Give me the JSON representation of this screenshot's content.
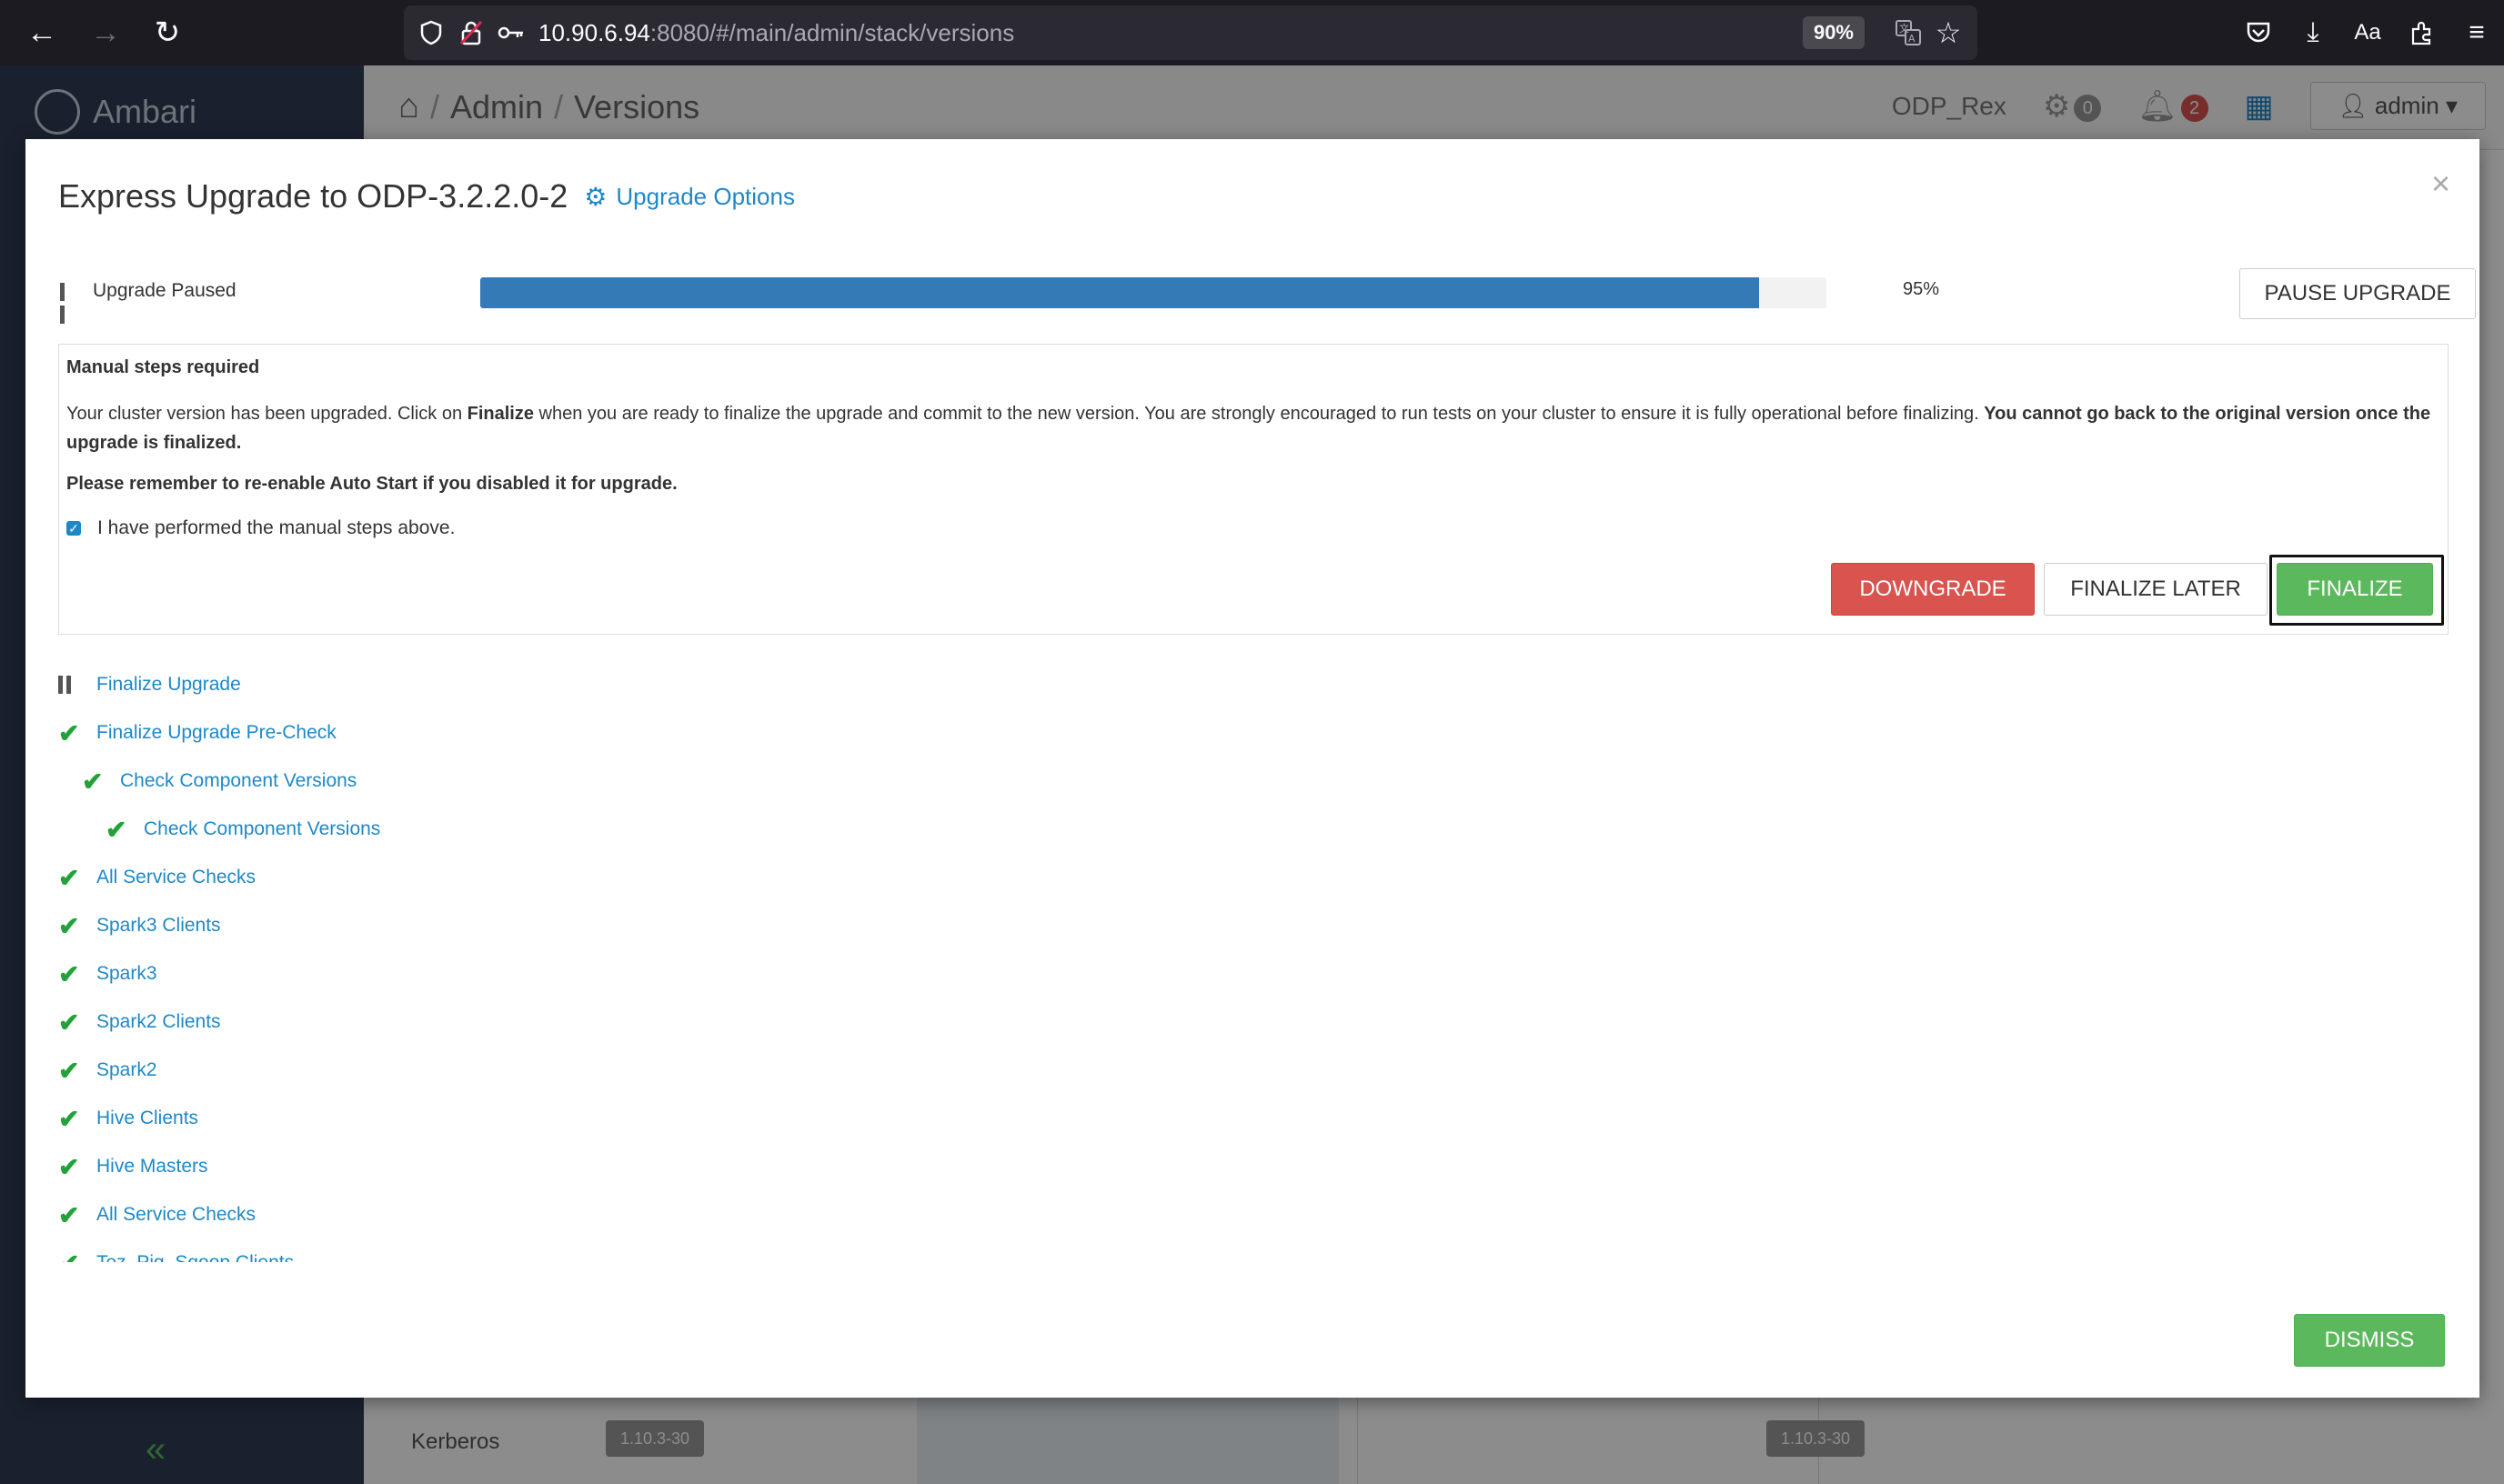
{
  "browser": {
    "url_host": "10.90.6.94",
    "url_rest": ":8080/#/main/admin/stack/versions",
    "zoom": "90%",
    "reader_label": "Aa"
  },
  "app": {
    "logo": "Ambari",
    "breadcrumb": [
      "Admin",
      "Versions"
    ],
    "cluster": "ODP_Rex",
    "ops_count": "0",
    "alerts_count": "2",
    "user": "admin",
    "bg_row_label": "Kerberos",
    "bg_versions": [
      "1.10.3-30",
      "1.10.3-30"
    ]
  },
  "modal": {
    "title": "Express Upgrade to ODP-3.2.2.0-2",
    "options_link": "Upgrade Options",
    "close": "×",
    "status_label": "Upgrade Paused",
    "progress": 95,
    "progress_text": "95%",
    "pause_button": "PAUSE UPGRADE",
    "manual": {
      "title": "Manual steps required",
      "msg_part1": "Your cluster version has been upgraded. Click on ",
      "msg_bold1": "Finalize",
      "msg_part2": " when you are ready to finalize the upgrade and commit to the new version. You are strongly encouraged to run tests on your cluster to ensure it is fully operational before finalizing. ",
      "msg_bold2": "You cannot go back to the original version once the upgrade is finalized.",
      "reminder": "Please remember to re-enable Auto Start if you disabled it for upgrade.",
      "ack_label": "I have performed the manual steps above.",
      "ack_checked": true
    },
    "buttons": {
      "downgrade": "DOWNGRADE",
      "finalize_later": "FINALIZE LATER",
      "finalize": "FINALIZE",
      "dismiss": "DISMISS"
    },
    "tasks": [
      {
        "label": "Finalize Upgrade",
        "status": "paused",
        "indent": 0
      },
      {
        "label": "Finalize Upgrade Pre-Check",
        "status": "done",
        "indent": 0
      },
      {
        "label": "Check Component Versions",
        "status": "done",
        "indent": 1
      },
      {
        "label": "Check Component Versions",
        "status": "done",
        "indent": 2
      },
      {
        "label": "All Service Checks",
        "status": "done",
        "indent": 0
      },
      {
        "label": "Spark3 Clients",
        "status": "done",
        "indent": 0
      },
      {
        "label": "Spark3",
        "status": "done",
        "indent": 0
      },
      {
        "label": "Spark2 Clients",
        "status": "done",
        "indent": 0
      },
      {
        "label": "Spark2",
        "status": "done",
        "indent": 0
      },
      {
        "label": "Hive Clients",
        "status": "done",
        "indent": 0
      },
      {
        "label": "Hive Masters",
        "status": "done",
        "indent": 0
      },
      {
        "label": "All Service Checks",
        "status": "done",
        "indent": 0
      },
      {
        "label": "Tez, Pig, Sqoop Clients",
        "status": "done",
        "indent": 0
      }
    ]
  }
}
